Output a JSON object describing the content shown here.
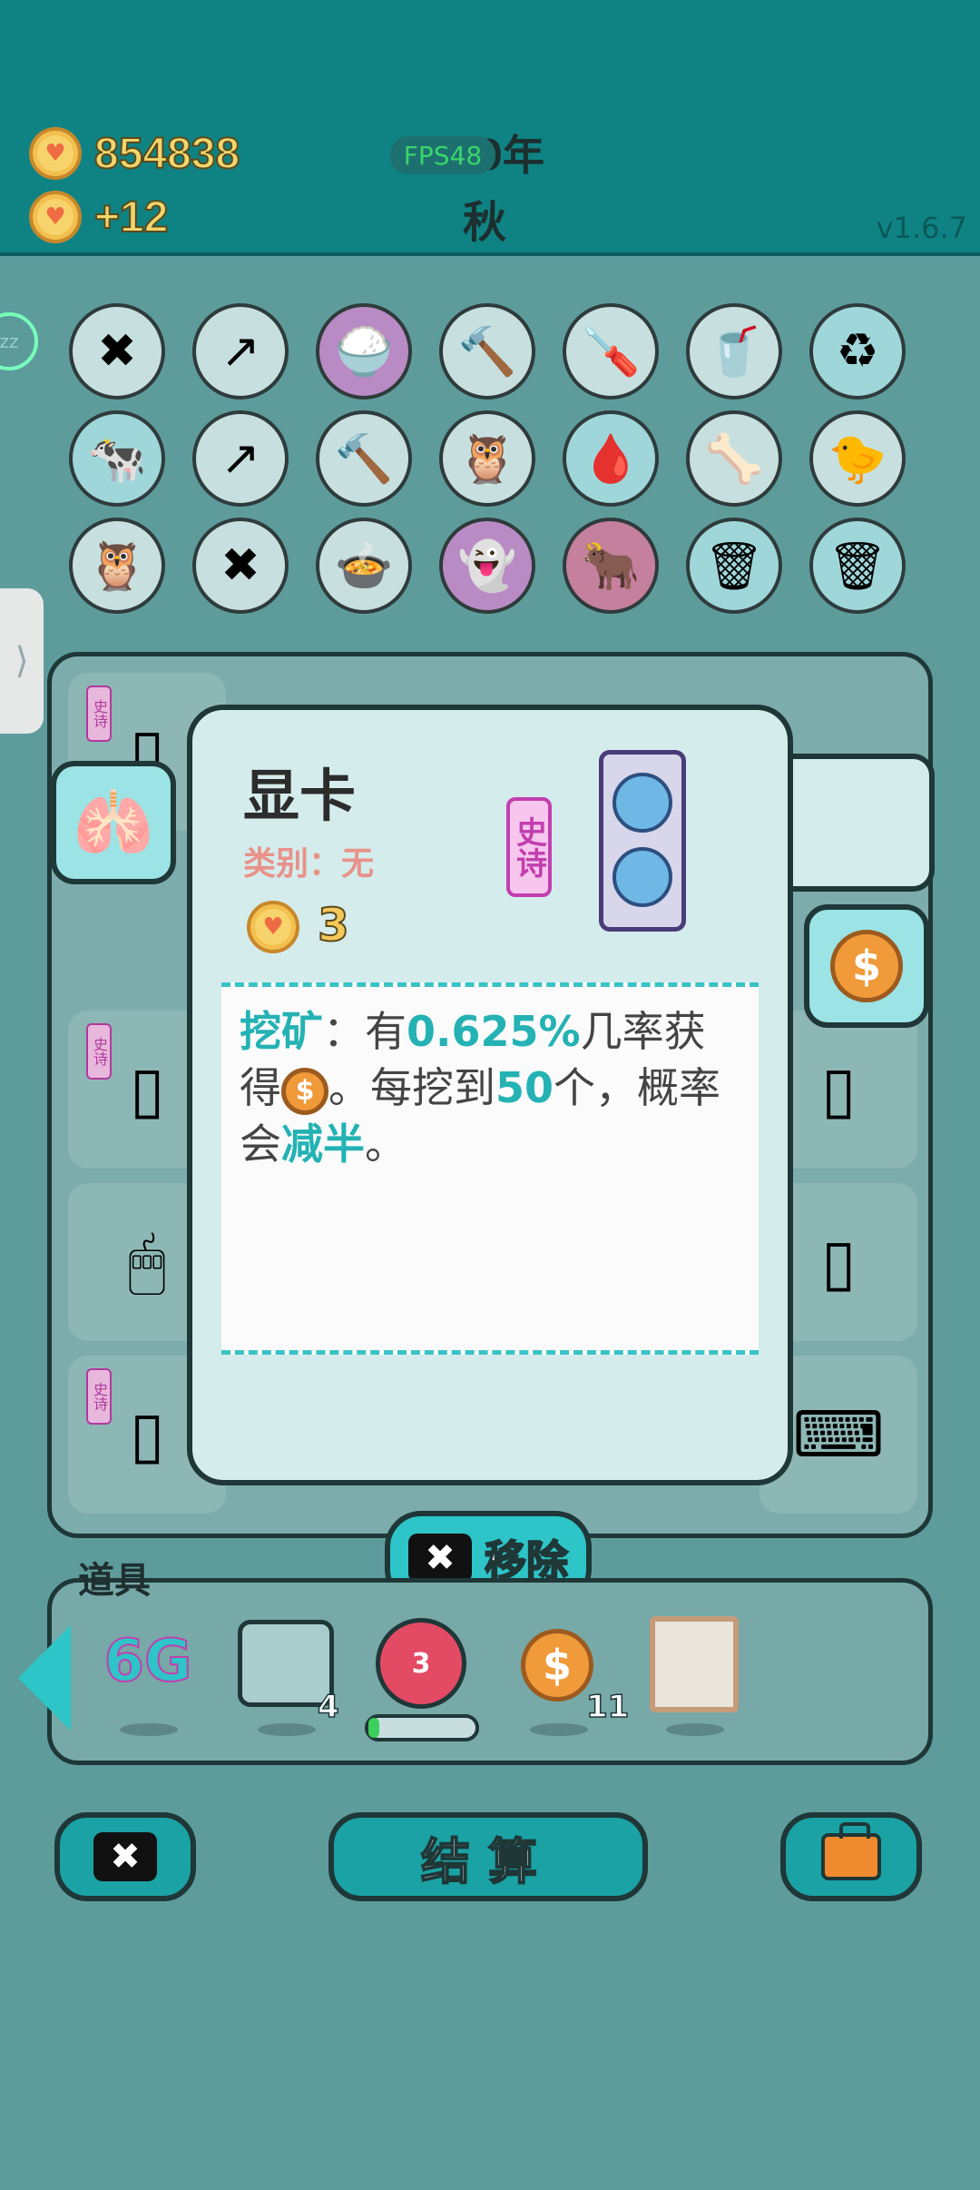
{
  "header": {
    "coins": "854838",
    "income": "+12",
    "year": "50年",
    "season": "秋",
    "fps": "FPS48",
    "version": "v1.6.7"
  },
  "card": {
    "title": "显卡",
    "category": "类别：无",
    "price": "3",
    "rarity": "史诗",
    "desc": {
      "p1": "挖矿",
      "p2": "：有",
      "p3": "0.625%",
      "p4": "几率获得",
      "p5": "。每挖到",
      "p6": "50",
      "p7": "个，概率会",
      "p8": "减半",
      "p9": "。"
    }
  },
  "remove_label": "移除",
  "props": {
    "title": "道具",
    "items": [
      {
        "label": "6G",
        "count": ""
      },
      {
        "label": "",
        "count": "4"
      },
      {
        "label": "3",
        "count": ""
      },
      {
        "label": "$",
        "count": "11"
      },
      {
        "label": "",
        "count": ""
      }
    ]
  },
  "bottom": {
    "settle_label": "结算"
  },
  "slot_tag": "史诗",
  "colors": {
    "accent": "#2ec5c8",
    "header": "#0f8383",
    "epic": "#c23fae",
    "coin": "#f2c85a"
  }
}
